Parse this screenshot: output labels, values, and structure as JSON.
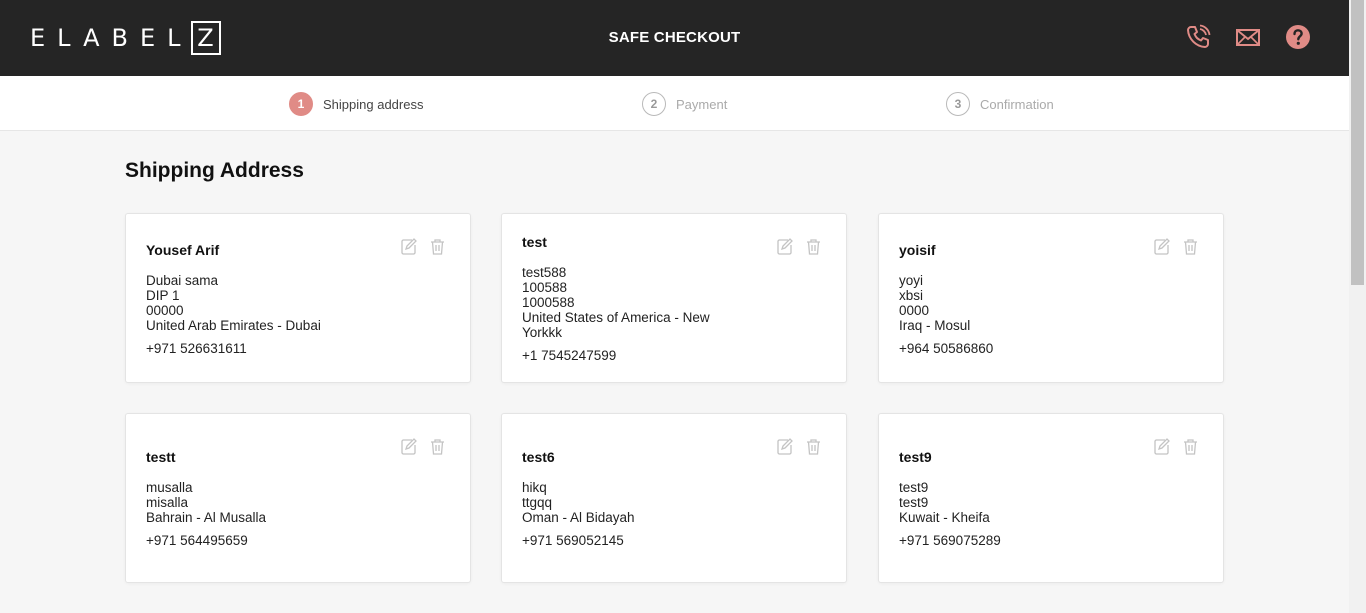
{
  "header": {
    "logo_text": "ELABEL",
    "logo_box_letter": "Z",
    "title": "SAFE CHECKOUT",
    "icons": [
      "phone-icon",
      "mail-icon",
      "help-icon"
    ],
    "accent": "#e08b86"
  },
  "steps": [
    {
      "num": "1",
      "label": "Shipping address",
      "active": true
    },
    {
      "num": "2",
      "label": "Payment",
      "active": false
    },
    {
      "num": "3",
      "label": "Confirmation",
      "active": false
    }
  ],
  "page_title": "Shipping Address",
  "addresses": [
    {
      "name": "Yousef Arif",
      "lines": [
        "Dubai sama",
        "DIP 1",
        "00000",
        "United Arab Emirates - Dubai"
      ],
      "phone": "+971 526631611"
    },
    {
      "name": "test",
      "lines": [
        "test588",
        "100588",
        "1000588",
        "United States of America - New",
        "Yorkkk"
      ],
      "phone": "+1 7545247599"
    },
    {
      "name": "yoisif",
      "lines": [
        "yoyi",
        "xbsi",
        "0000",
        "Iraq - Mosul"
      ],
      "phone": "+964 50586860"
    },
    {
      "name": "testt",
      "lines": [
        "musalla",
        "misalla",
        "Bahrain - Al Musalla"
      ],
      "phone": "+971 564495659"
    },
    {
      "name": "test6",
      "lines": [
        "hikq",
        "ttgqq",
        "Oman - Al Bidayah"
      ],
      "phone": "+971 569052145"
    },
    {
      "name": "test9",
      "lines": [
        "test9",
        "test9",
        "Kuwait - Kheifa"
      ],
      "phone": "+971 569075289"
    }
  ]
}
